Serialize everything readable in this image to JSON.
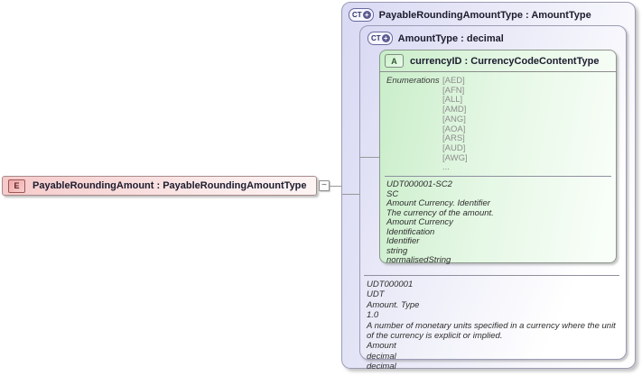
{
  "colors": {
    "complex_type_fill": "#d9d9f4",
    "attribute_fill": "#c9edc9",
    "element_fill": "#f6caca",
    "box_border": "#9b9bb5",
    "connector": "#999999"
  },
  "diagram": {
    "element": {
      "icon_label": "E",
      "title": "PayableRoundingAmount : PayableRoundingAmountType"
    },
    "collapse_glyph": "−",
    "outer_type": {
      "icon_label": "CT",
      "icon_plus": "+",
      "title": "PayableRoundingAmountType : AmountType"
    },
    "inner_type": {
      "icon_label": "CT",
      "icon_plus": "+",
      "title": "AmountType : decimal",
      "annotation_lines": [
        "UDT000001",
        "UDT",
        "Amount. Type",
        "1.0",
        "A number of monetary units specified in a currency where the unit of the currency is explicit or implied.",
        "Amount",
        "decimal",
        "decimal"
      ]
    },
    "attribute": {
      "icon_label": "A",
      "title": "currencyID : CurrencyCodeContentType",
      "enumerations_label": "Enumerations",
      "enumeration_values": [
        "[AED]",
        "[AFN]",
        "[ALL]",
        "[AMD]",
        "[ANG]",
        "[AOA]",
        "[ARS]",
        "[AUD]",
        "[AWG]",
        "..."
      ],
      "annotation_lines": [
        "UDT000001-SC2",
        "SC",
        "Amount Currency. Identifier",
        "The currency of the amount.",
        "Amount Currency",
        "Identification",
        "Identifier",
        "string",
        "normalisedString"
      ]
    }
  }
}
